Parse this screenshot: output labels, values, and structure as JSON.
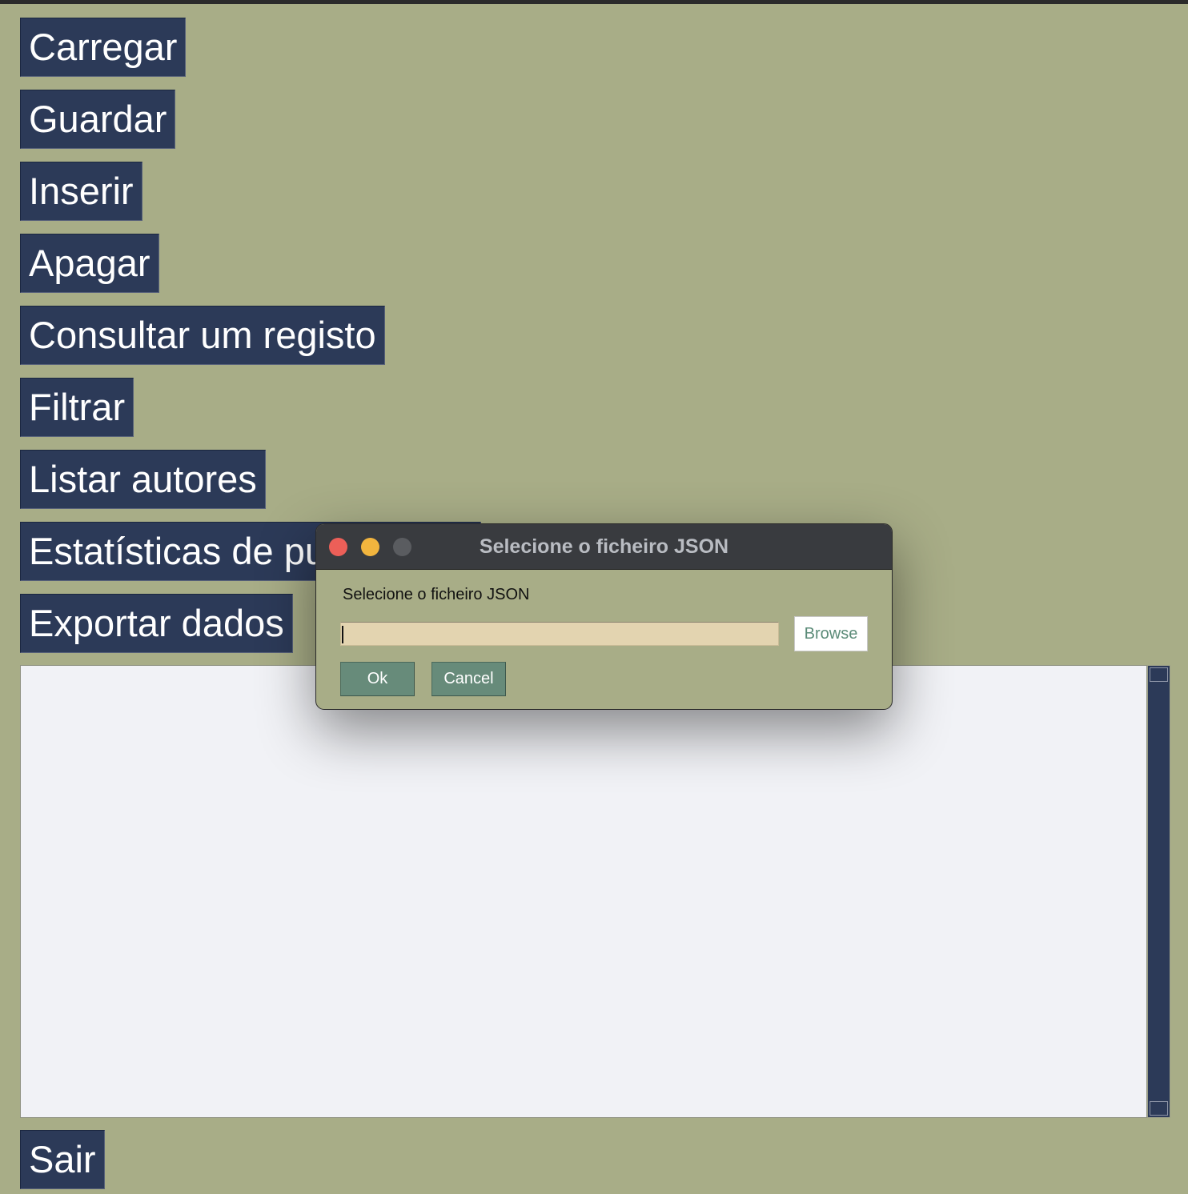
{
  "main": {
    "buttons": {
      "carregar": "Carregar",
      "guardar": "Guardar",
      "inserir": "Inserir",
      "apagar": "Apagar",
      "consultar": "Consultar um registo",
      "filtrar": "Filtrar",
      "listar_autores": "Listar autores",
      "estatisticas": "Estatísticas de pu",
      "exportar": "Exportar dados",
      "sair": "Sair"
    },
    "output_text": ""
  },
  "dialog": {
    "title": "Selecione o ficheiro JSON",
    "prompt": "Selecione o ficheiro JSON",
    "input_value": "",
    "browse_label": "Browse",
    "ok_label": "Ok",
    "cancel_label": "Cancel"
  },
  "colors": {
    "background": "#a8ad87",
    "button_bg": "#2c3a58",
    "dialog_button_bg": "#678b7a",
    "input_bg": "#e3d4b0",
    "output_bg": "#f1f2f6",
    "titlebar_bg": "#393b3f"
  },
  "icons": {
    "close": "close-traffic-light-icon",
    "minimize": "minimize-traffic-light-icon",
    "maximize": "maximize-traffic-light-icon"
  }
}
